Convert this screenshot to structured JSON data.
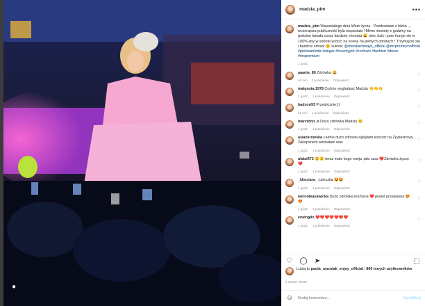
{
  "post": {
    "username": "madzia_pim",
    "caption_user": "madzia_pim",
    "caption_text": "Wspaniałego dnia Wam życzę . Pozdrawiam z łóżka … wczorajsza publiczność była wspaniała ! Mimo niestety z godziny na godzinę łamała coraz bardziej choroba 😩 wiec dziś i jutro kuruje się w 100% aby w sobote wrócić na scenę na pełnych obrotach ! Trzymajcie sie i badźcie zdrowi 😊 suknia:",
    "caption_tags": "@monikachwajol_official @mcpremiumofficial #pieknamloda #singer #lovemyjob #kocham #fashion #dress #mcpremium",
    "caption_time": "2 godz."
  },
  "comments": [
    {
      "user": "aaania_89",
      "text": "Zdrówka 😃",
      "time": "46 min",
      "likes": "1 polubienie",
      "reply": "Odpowiedz"
    },
    {
      "user": "malgosia.1978",
      "text": "Cudnie wygladasz Madziu 👏👏👏",
      "time": "1 godz.",
      "likes": "1 polubienie",
      "reply": "Odpowiedz"
    },
    {
      "user": "badzon93",
      "text": "Przeslicznie:))",
      "time": "21 min",
      "likes": "1 polubienie",
      "reply": "Odpowiedz"
    },
    {
      "user": "marcinnn_o",
      "text": "Duzo zdrówka Madziu 😊",
      "time": "1 godz.",
      "likes": "1 polubienie",
      "reply": "Odpowiedz"
    },
    {
      "user": "asiazurowska",
      "text": "Ładnie dużo zdrowia oglądam koncert na Żywiestrowy Zakopanem widziałam was",
      "time": "1 godz.",
      "likes": "1 polubienie",
      "reply": "Odpowiedz"
    },
    {
      "user": "ulalal473",
      "text": "😟😟 teraz mało kogo omija ,taki czas ❤️Zdrówka życzę ❤️",
      "time": "1 godz.",
      "likes": "1 polubienie",
      "reply": "Odpowiedz"
    },
    {
      "user": "_kkociara_",
      "text": "Laleczka 😍😍",
      "time": "1 godz.",
      "likes": "1 polubienie",
      "reply": "Odpowiedz"
    },
    {
      "user": "weronikasawicka",
      "text": "Duzo zdrówka kochana ❤️ jesteś przepiękna 😍😍",
      "time": "1 godz.",
      "likes": "1 polubienie",
      "reply": "Odpowiedz"
    },
    {
      "user": "erwinglin",
      "text": "❤️❤️❤️❤️❤️❤️❤️",
      "time": "1 godz.",
      "likes": "1 polubienie",
      "reply": "Odpowiedz"
    }
  ],
  "likes_line": {
    "prefix": "Lubią to",
    "user": "paula_wozniak_enjoy_official",
    "and": "i",
    "others": "860 innych użytkowników"
  },
  "post_time": "2 GODZ. TEMU",
  "add_comment": {
    "placeholder": "Dodaj komentarz...",
    "post_label": "Opublikuj"
  },
  "icons": {
    "heart": "heart-icon",
    "comment": "comment-icon",
    "share": "share-icon",
    "save": "bookmark-icon",
    "more": "more-icon",
    "emoji": "emoji-icon",
    "user-tag": "user-tag-icon"
  }
}
